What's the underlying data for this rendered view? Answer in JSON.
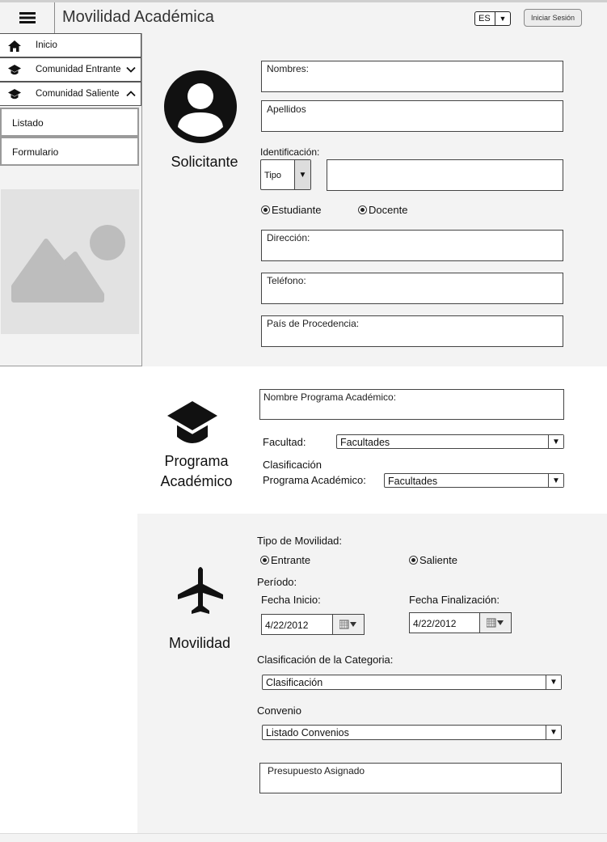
{
  "header": {
    "title": "Movilidad Académica",
    "menu_icon": "hamburger-menu-icon",
    "language": "ES",
    "login_label": "Iniciar Sesión"
  },
  "sidebar": {
    "items": [
      {
        "label": "Inicio",
        "icon": "home-icon"
      },
      {
        "label": "Comunidad Entrante",
        "icon": "graduation-cap-icon",
        "chevron": "chevron-down-icon"
      },
      {
        "label": "Comunidad Saliente",
        "icon": "graduation-cap-icon",
        "chevron": "chevron-up-icon"
      }
    ],
    "subitems": [
      "Listado",
      "Formulario"
    ],
    "image": "image-placeholder-icon"
  },
  "solicitante": {
    "section_label": "Solicitante",
    "icon": "user-avatar-icon",
    "nombres_placeholder": "Nombres:",
    "apellidos_placeholder": "Apellidos",
    "identificacion_label": "Identificación:",
    "tipo_value": "Tipo",
    "radio_estudiante": "Estudiante",
    "radio_docente": "Docente",
    "direccion_placeholder": "Dirección:",
    "telefono_placeholder": "Teléfono:",
    "pais_placeholder": "País de Procedencia:"
  },
  "programa": {
    "section_label_line1": "Programa",
    "section_label_line2": "Académico",
    "icon": "graduation-cap-icon",
    "nombre_placeholder": "Nombre Programa Académico:",
    "facultad_label": "Facultad:",
    "facultad_value": "Facultades",
    "clasificacion_label_line1": "Clasificación",
    "clasificacion_label_line2": "Programa Académico:",
    "clasificacion_value": "Facultades"
  },
  "movilidad": {
    "section_label": "Movilidad",
    "icon": "airplane-icon",
    "tipo_label": "Tipo de Movilidad:",
    "radio_entrante": "Entrante",
    "radio_saliente": "Saliente",
    "periodo_label": "Período:",
    "fecha_inicio_label": "Fecha Inicio:",
    "fecha_inicio_value": "4/22/2012",
    "fecha_fin_label": "Fecha Finalización:",
    "fecha_fin_value": "4/22/2012",
    "categoria_label": "Clasificación de la Categoria:",
    "categoria_value": "Clasificación",
    "convenio_label": "Convenio",
    "convenio_value": "Listado Convenios",
    "presupuesto_placeholder": "Presupuesto Asignado"
  }
}
